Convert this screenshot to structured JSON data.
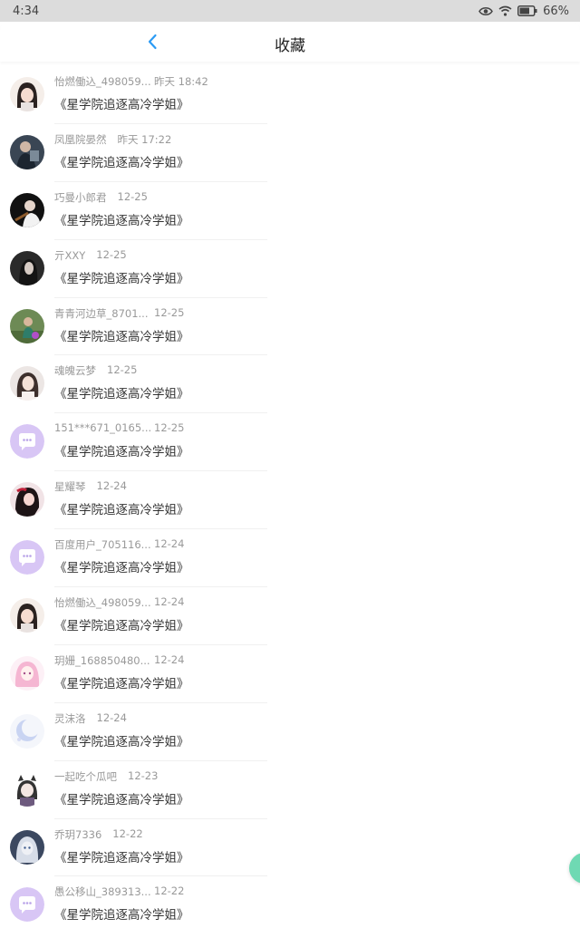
{
  "status": {
    "time": "4:34",
    "battery": "66%"
  },
  "header": {
    "title": "收藏"
  },
  "items": [
    {
      "name": "怡燃働込_498059...",
      "time": "昨天 18:42",
      "title": "《星学院追逐高冷学姐》",
      "avatar": "girl-dark-hair"
    },
    {
      "name": "凤凰院晏然",
      "time": "昨天 17:22",
      "title": "《星学院追逐高冷学姐》",
      "avatar": "boy-dark"
    },
    {
      "name": "巧曼小郎君",
      "time": "12-25",
      "title": "《星学院追逐高冷学姐》",
      "avatar": "boy-guitar"
    },
    {
      "name": "亓XXY",
      "time": "12-25",
      "title": "《星学院追逐高冷学姐》",
      "avatar": "girl-shadow"
    },
    {
      "name": "青青河边草_8701...",
      "time": "12-25",
      "title": "《星学院追逐高冷学姐》",
      "avatar": "outdoor-photo"
    },
    {
      "name": "魂魄云梦",
      "time": "12-25",
      "title": "《星学院追逐高冷学姐》",
      "avatar": "girl-light"
    },
    {
      "name": "151***671_0165...",
      "time": "12-25",
      "title": "《星学院追逐高冷学姐》",
      "avatar": "default-chat"
    },
    {
      "name": "星耀琴",
      "time": "12-24",
      "title": "《星学院追逐高冷学姐》",
      "avatar": "girl-red"
    },
    {
      "name": "百度用户_705116...",
      "time": "12-24",
      "title": "《星学院追逐高冷学姐》",
      "avatar": "default-chat"
    },
    {
      "name": "怡燃働込_498059...",
      "time": "12-24",
      "title": "《星学院追逐高冷学姐》",
      "avatar": "girl-dark-hair"
    },
    {
      "name": "玥姗_168850480...",
      "time": "12-24",
      "title": "《星学院追逐高冷学姐》",
      "avatar": "girl-pink"
    },
    {
      "name": "灵沫洛",
      "time": "12-24",
      "title": "《星学院追逐高冷学姐》",
      "avatar": "moon-blue"
    },
    {
      "name": "一起吃个瓜吧",
      "time": "12-23",
      "title": "《星学院追逐高冷学姐》",
      "avatar": "cat-girl"
    },
    {
      "name": "乔玥7336",
      "time": "12-22",
      "title": "《星学院追逐高冷学姐》",
      "avatar": "girl-blue"
    },
    {
      "name": "愚公移山_389313...",
      "time": "12-22",
      "title": "《星学院追逐高冷学姐》",
      "avatar": "default-chat"
    }
  ],
  "colors": {
    "accent": "#2b9bf4",
    "default_avatar": "#d8c6f5",
    "floating": "#6fd9b3"
  }
}
